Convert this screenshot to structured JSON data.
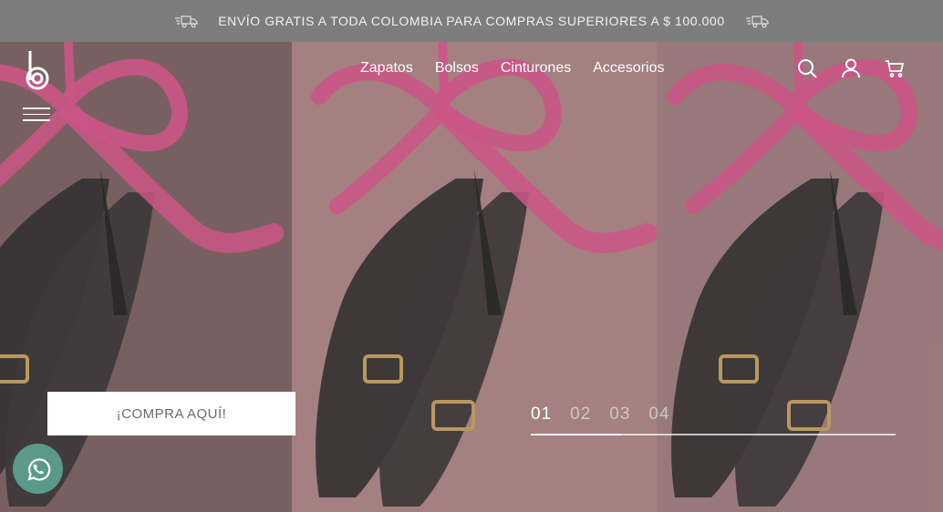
{
  "announcement": {
    "text": "ENVÍO GRATIS A TODA COLOMBIA PARA COMPRAS SUPERIORES A $ 100.000",
    "icon": "delivery-truck-icon"
  },
  "nav": {
    "logo": "b",
    "links": [
      {
        "label": "Zapatos"
      },
      {
        "label": "Bolsos"
      },
      {
        "label": "Cinturones"
      },
      {
        "label": "Accesorios"
      }
    ],
    "icons": [
      "search-icon",
      "user-icon",
      "cart-icon"
    ]
  },
  "hero": {
    "cta_label": "¡COMPRA AQUÍ!",
    "slides": [
      "01",
      "02",
      "03",
      "04"
    ],
    "active_slide": "01",
    "slide_progress": 0.25
  },
  "colors": {
    "ribbon": "#e0508c",
    "announcement_bg": "#7d7d7d",
    "whatsapp": "#5b9a8a"
  }
}
